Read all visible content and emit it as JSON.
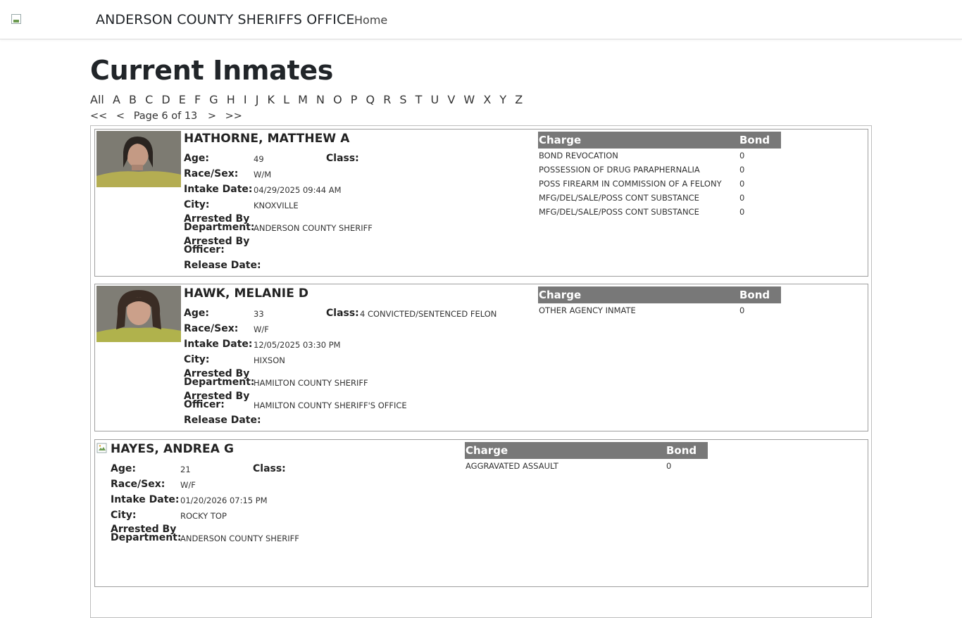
{
  "nav": {
    "brand": "ANDERSON COUNTY SHERIFFS OFFICE",
    "home": "Home"
  },
  "page_title": "Current Inmates",
  "alphabet": [
    "All",
    "A",
    "B",
    "C",
    "D",
    "E",
    "F",
    "G",
    "H",
    "I",
    "J",
    "K",
    "L",
    "M",
    "N",
    "O",
    "P",
    "Q",
    "R",
    "S",
    "T",
    "U",
    "V",
    "W",
    "X",
    "Y",
    "Z"
  ],
  "pager": {
    "first": "<<",
    "prev": "<",
    "text": "Page 6 of 13",
    "next": ">",
    "last": ">>"
  },
  "labels": {
    "age": "Age:",
    "class": "Class:",
    "race_sex": "Race/Sex:",
    "intake": "Intake Date:",
    "city": "City:",
    "arrested_by_dept_1": "Arrested By",
    "arrested_by_dept_2": "Department:",
    "arrested_by_off_1": "Arrested By",
    "arrested_by_off_2": "Officer:",
    "release": "Release Date:",
    "charge_col": "Charge",
    "bond_col": "Bond"
  },
  "inmates": [
    {
      "name": "HATHORNE, MATTHEW A",
      "age": "49",
      "class": "",
      "race_sex": "W/M",
      "intake": "04/29/2025 09:44 AM",
      "city": "KNOXVILLE",
      "department": "ANDERSON COUNTY SHERIFF",
      "officer": "",
      "release": "",
      "charges": [
        {
          "charge": "BOND REVOCATION",
          "bond": "0"
        },
        {
          "charge": "POSSESSION OF DRUG PARAPHERNALIA",
          "bond": "0"
        },
        {
          "charge": "POSS FIREARM IN COMMISSION OF A FELONY",
          "bond": "0"
        },
        {
          "charge": "MFG/DEL/SALE/POSS CONT SUBSTANCE",
          "bond": "0"
        },
        {
          "charge": "MFG/DEL/SALE/POSS CONT SUBSTANCE",
          "bond": "0"
        }
      ]
    },
    {
      "name": "HAWK, MELANIE D",
      "age": "33",
      "class": "4 CONVICTED/SENTENCED FELON",
      "race_sex": "W/F",
      "intake": "12/05/2025 03:30 PM",
      "city": "HIXSON",
      "department": "HAMILTON COUNTY SHERIFF",
      "officer": "HAMILTON COUNTY SHERIFF'S OFFICE",
      "release": "",
      "charges": [
        {
          "charge": "OTHER AGENCY INMATE",
          "bond": "0"
        }
      ]
    },
    {
      "name": "HAYES, ANDREA G",
      "age": "21",
      "class": "",
      "race_sex": "W/F",
      "intake": "01/20/2026 07:15 PM",
      "city": "ROCKY TOP",
      "department": "ANDERSON COUNTY SHERIFF",
      "officer": "",
      "release": "",
      "charges": [
        {
          "charge": "AGGRAVATED ASSAULT",
          "bond": "0"
        }
      ]
    }
  ]
}
